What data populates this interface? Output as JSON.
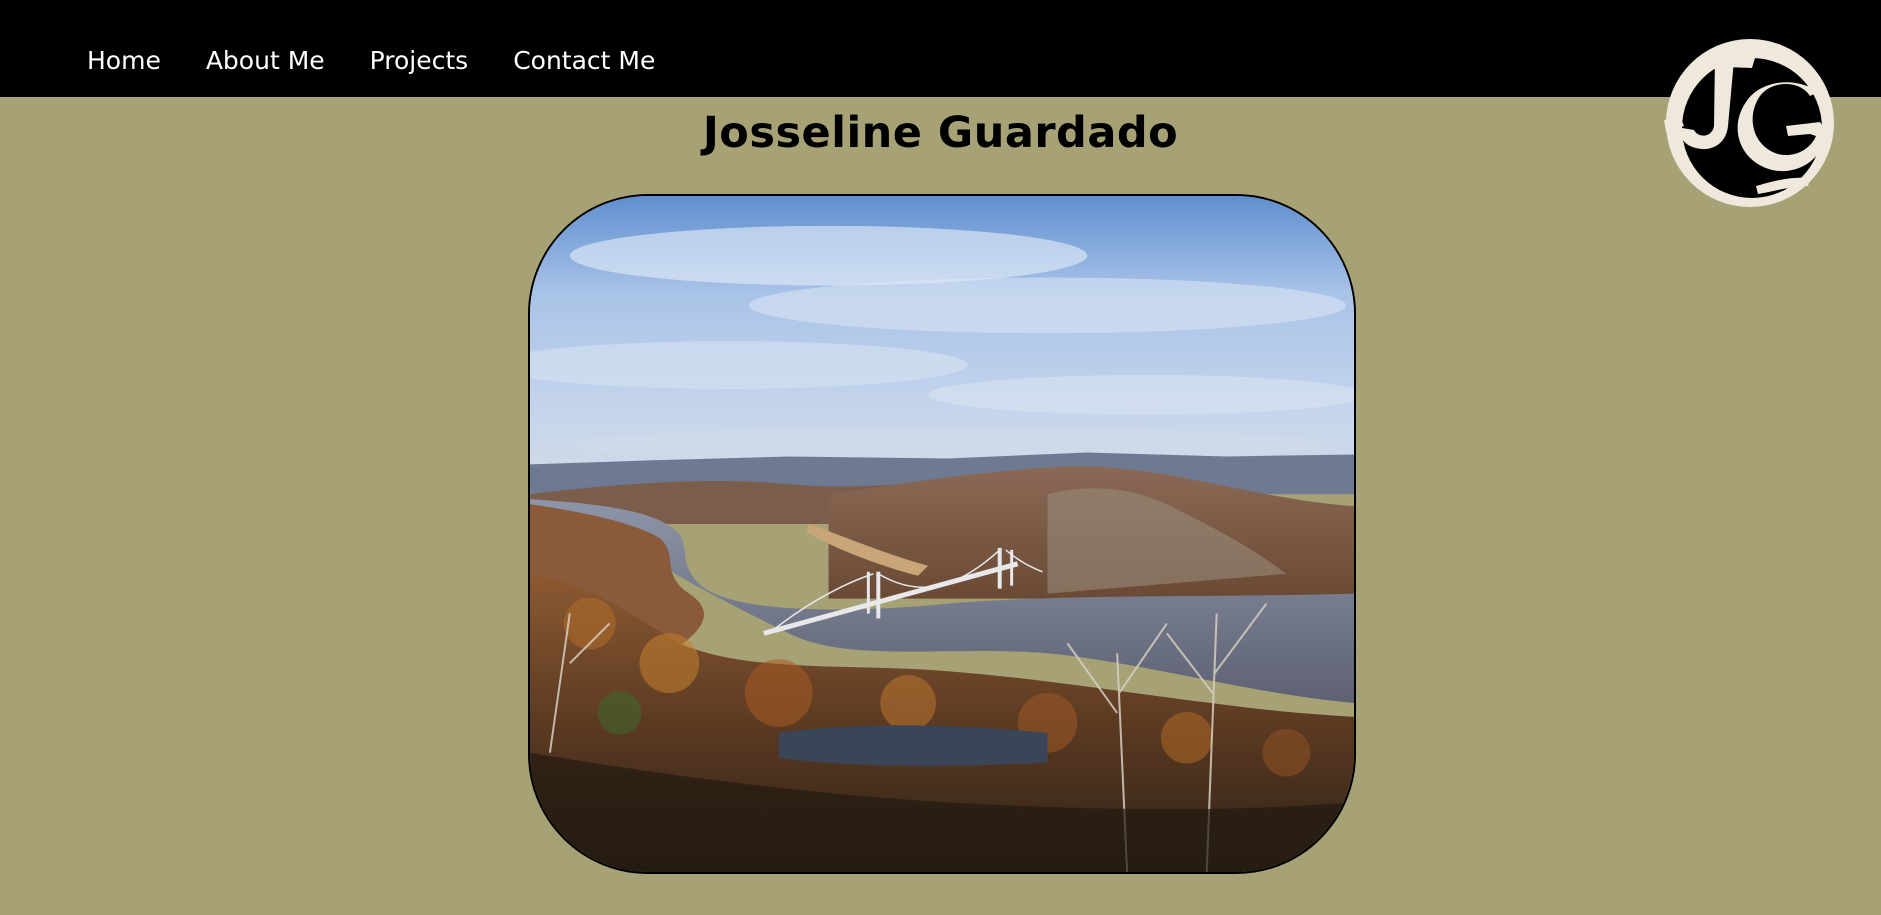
{
  "nav": {
    "items": [
      {
        "label": "Home"
      },
      {
        "label": "About Me"
      },
      {
        "label": "Projects"
      },
      {
        "label": "Contact Me"
      }
    ]
  },
  "logo": {
    "text": "JG"
  },
  "page": {
    "title": "Josseline Guardado"
  },
  "colors": {
    "background": "#a6a276",
    "topbar": "#000000",
    "nav_text": "#ffffff",
    "logo_fill": "#efe8dc"
  },
  "hero": {
    "subject": "river valley with suspension bridge and autumn hills"
  }
}
